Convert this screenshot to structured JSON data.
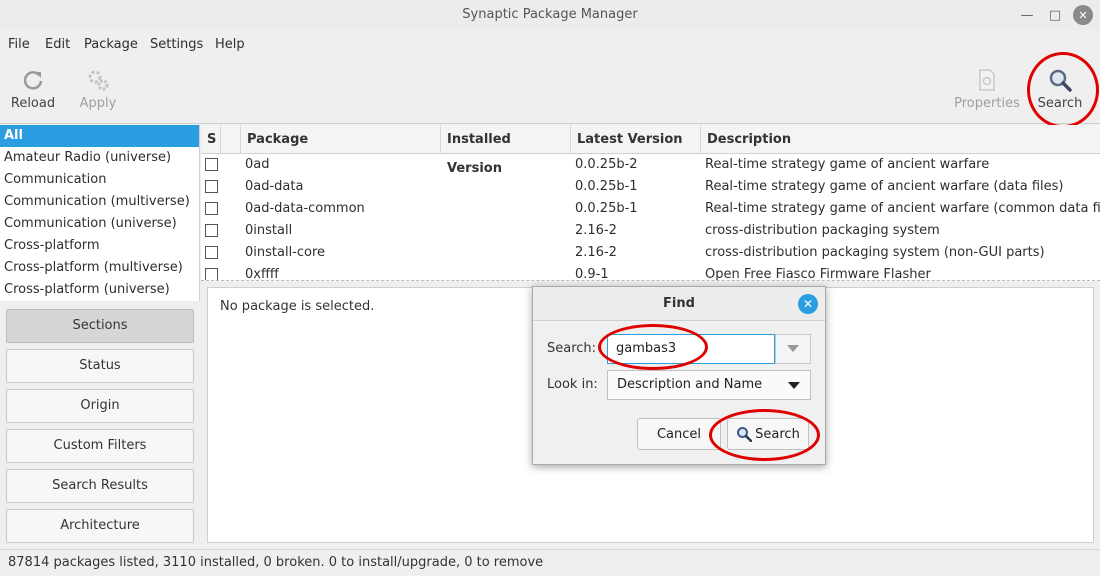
{
  "window": {
    "title": "Synaptic Package Manager",
    "minimize_glyph": "—",
    "maximize_glyph": "□",
    "close_glyph": "✕"
  },
  "menu": {
    "items": [
      "File",
      "Edit",
      "Package",
      "Settings",
      "Help"
    ]
  },
  "toolbar": {
    "reload": {
      "label": "Reload",
      "icon": "reload-icon"
    },
    "apply": {
      "label": "Apply",
      "icon": "gears-icon"
    },
    "properties": {
      "label": "Properties",
      "icon": "properties-icon"
    },
    "search": {
      "label": "Search",
      "icon": "magnifier-icon"
    }
  },
  "sections": {
    "items": [
      "All",
      "Amateur Radio (universe)",
      "Communication",
      "Communication (multiverse)",
      "Communication (universe)",
      "Cross-platform",
      "Cross-platform (multiverse)",
      "Cross-platform (universe)"
    ],
    "selected": "All"
  },
  "filter_buttons": [
    "Sections",
    "Status",
    "Origin",
    "Custom Filters",
    "Search Results",
    "Architecture"
  ],
  "table": {
    "headers": {
      "s": "S",
      "package": "Package",
      "installed": "Installed Version",
      "latest": "Latest Version",
      "description": "Description"
    },
    "rows": [
      {
        "package": "0ad",
        "installed": "",
        "latest": "0.0.25b-2",
        "description": "Real-time strategy game of ancient warfare"
      },
      {
        "package": "0ad-data",
        "installed": "",
        "latest": "0.0.25b-1",
        "description": "Real-time strategy game of ancient warfare (data files)"
      },
      {
        "package": "0ad-data-common",
        "installed": "",
        "latest": "0.0.25b-1",
        "description": "Real-time strategy game of ancient warfare (common data files)"
      },
      {
        "package": "0install",
        "installed": "",
        "latest": "2.16-2",
        "description": "cross-distribution packaging system"
      },
      {
        "package": "0install-core",
        "installed": "",
        "latest": "2.16-2",
        "description": "cross-distribution packaging system (non-GUI parts)"
      },
      {
        "package": "0xffff",
        "installed": "",
        "latest": "0.9-1",
        "description": "Open Free Fiasco Firmware Flasher"
      }
    ]
  },
  "detail": {
    "message": "No package is selected."
  },
  "status": {
    "text": "87814 packages listed, 3110 installed, 0 broken. 0 to install/upgrade, 0 to remove"
  },
  "find_dialog": {
    "title": "Find",
    "close_glyph": "✕",
    "search_label": "Search:",
    "search_value": "gambas3",
    "look_in_label": "Look in:",
    "look_in_value": "Description and Name",
    "cancel_label": "Cancel",
    "search_button_label": "Search"
  },
  "colors": {
    "accent": "#2a9ee0",
    "annotation": "#e00000"
  }
}
